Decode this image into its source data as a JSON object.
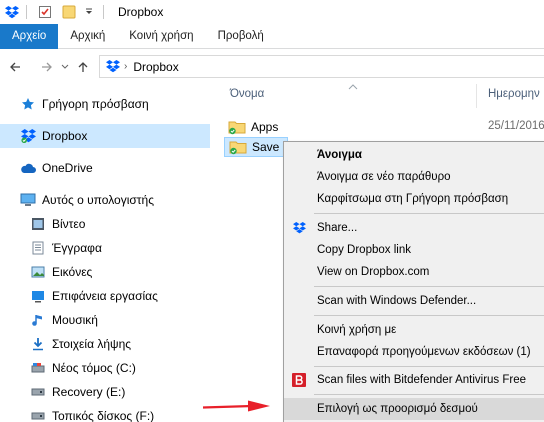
{
  "titlebar": {
    "title": "Dropbox"
  },
  "ribbon": {
    "tabs": [
      {
        "label": "Αρχείο",
        "active": true
      },
      {
        "label": "Αρχική",
        "active": false
      },
      {
        "label": "Κοινή χρήση",
        "active": false
      },
      {
        "label": "Προβολή",
        "active": false
      }
    ]
  },
  "address": {
    "path": [
      "Dropbox"
    ]
  },
  "nav": {
    "items": [
      {
        "label": "Γρήγορη πρόσβαση",
        "icon": "star-icon"
      },
      {
        "label": "Dropbox",
        "icon": "dropbox-icon",
        "selected": true
      },
      {
        "label": "OneDrive",
        "icon": "onedrive-icon"
      },
      {
        "label": "Αυτός ο υπολογιστής",
        "icon": "computer-icon"
      },
      {
        "label": "Βίντεο",
        "icon": "video-icon"
      },
      {
        "label": "Έγγραφα",
        "icon": "documents-icon"
      },
      {
        "label": "Εικόνες",
        "icon": "pictures-icon"
      },
      {
        "label": "Επιφάνεια εργασίας",
        "icon": "desktop-icon"
      },
      {
        "label": "Μουσική",
        "icon": "music-icon"
      },
      {
        "label": "Στοιχεία λήψης",
        "icon": "downloads-icon"
      },
      {
        "label": "Νέος τόμος (C:)",
        "icon": "drive-icon"
      },
      {
        "label": "Recovery (E:)",
        "icon": "drive-icon"
      },
      {
        "label": "Τοπικός δίσκος (F:)",
        "icon": "drive-icon"
      }
    ]
  },
  "files": {
    "columns": {
      "name": "Όνομα",
      "date": "Ημερομην"
    },
    "rows": [
      {
        "name": "Apps",
        "date": "25/11/2016"
      },
      {
        "name": "Save",
        "date": "",
        "selected": true
      }
    ]
  },
  "context_menu": {
    "items": [
      {
        "label": "Άνοιγμα",
        "bold": true
      },
      {
        "label": "Άνοιγμα σε νέο παράθυρο"
      },
      {
        "label": "Καρφίτσωμα στη Γρήγορη πρόσβαση"
      },
      {
        "label": "Share...",
        "icon": "dropbox-icon"
      },
      {
        "label": "Copy Dropbox link"
      },
      {
        "label": "View on Dropbox.com"
      },
      {
        "label": "Scan with Windows Defender..."
      },
      {
        "label": "Κοινή χρήση με"
      },
      {
        "label": "Επαναφορά προηγούμενων εκδόσεων (1)"
      },
      {
        "label": "Scan files with Bitdefender Antivirus Free",
        "icon": "bitdefender-icon"
      },
      {
        "label": "Επιλογή ως προορισμό δεσμού",
        "highlighted": true
      }
    ]
  },
  "colors": {
    "accent": "#1979ca",
    "selection": "#cce8ff",
    "arrow": "#e8202a",
    "menu_bg": "#f0f0f0"
  }
}
